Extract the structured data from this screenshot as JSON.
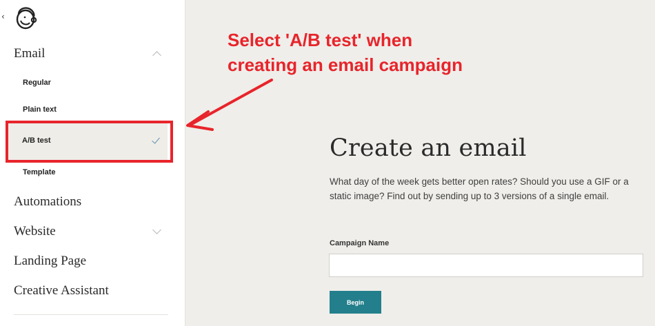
{
  "annotation": {
    "line1": "Select 'A/B test' when",
    "line2": "creating an email campaign"
  },
  "sidebar": {
    "back_icon": "chevron-left-icon",
    "logo_icon": "freddie-logo-icon",
    "email_label": "Email",
    "sub_items": [
      "Regular",
      "Plain text",
      "A/B test",
      "Template"
    ],
    "selected_item": "A/B test",
    "items": [
      "Automations",
      "Website",
      "Landing Page",
      "Creative Assistant"
    ]
  },
  "main": {
    "title": "Create an email",
    "description": "What day of the week gets better open rates? Should you use a GIF or a static image? Find out by sending up to 3 versions of a single email.",
    "campaign_label": "Campaign Name",
    "campaign_value": "",
    "begin_label": "Begin"
  },
  "colors": {
    "accent_red": "#e8242b",
    "button_teal": "#237f8c",
    "check_blue": "#5c8fb3"
  }
}
